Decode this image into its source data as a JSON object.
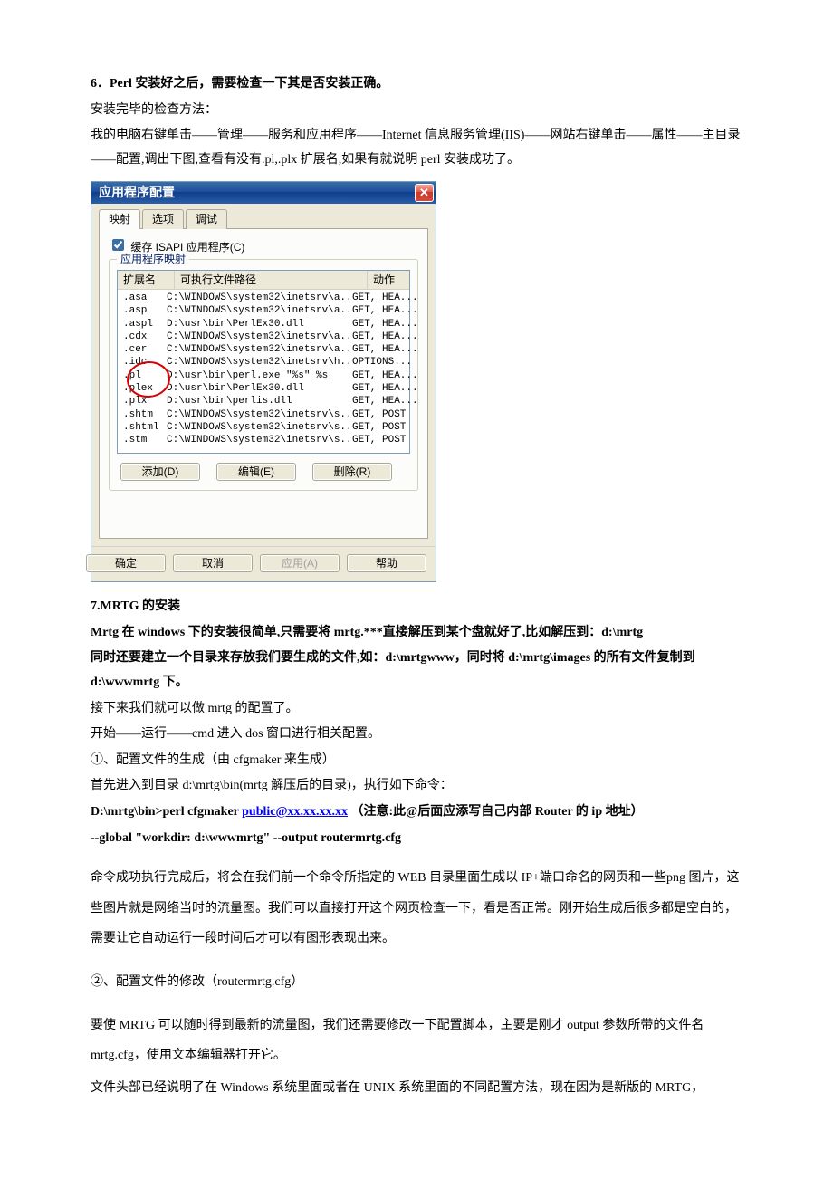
{
  "doc": {
    "step6_title": "6．Perl 安装好之后，需要检查一下其是否安装正确。",
    "check_method": "安装完毕的检查方法：",
    "check_path": "我的电脑右键单击——管理——服务和应用程序——Internet 信息服务管理(IIS)——网站右键单击——属性——主目录——配置,调出下图,查看有没有.pl,.plx 扩展名,如果有就说明 perl 安装成功了。",
    "step7_title": "7.MRTG 的安装",
    "mrtg1": "Mrtg 在 windows 下的安装很简单,只需要将 mrtg.***直接解压到某个盘就好了,比如解压到：d:\\mrtg",
    "mrtg2": "同时还要建立一个目录来存放我们要生成的文件,如：d:\\mrtgwww，同时将 d:\\mrtg\\images 的所有文件复制到 d:\\wwwmrtg 下。",
    "mrtg3": "接下来我们就可以做 mrtg 的配置了。",
    "mrtg4": "开始——运行——cmd 进入 dos 窗口进行相关配置。",
    "mrtg5": "①、配置文件的生成（由 cfgmaker 来生成）",
    "mrtg6": "首先进入到目录 d:\\mrtg\\bin(mrtg 解压后的目录)，执行如下命令：",
    "mrtg7a": "D:\\mrtg\\bin>perl cfgmaker   ",
    "mrtg7_link": "public@xx.xx.xx.xx",
    "mrtg7b": "（注意:此@后面应添写自己内部 Router 的 ip 地址）",
    "mrtg8": "--global \"workdir: d:\\wwwmrtg\" --output routermrtg.cfg",
    "mrtg9": "命令成功执行完成后，将会在我们前一个命令所指定的 WEB 目录里面生成以 IP+端口命名的网页和一些png 图片，这些图片就是网络当时的流量图。我们可以直接打开这个网页检查一下，看是否正常。刚开始生成后很多都是空白的，需要让它自动运行一段时间后才可以有图形表现出来。",
    "mrtg10": "②、配置文件的修改（routermrtg.cfg）",
    "mrtg11": "要使 MRTG 可以随时得到最新的流量图，我们还需要修改一下配置脚本，主要是刚才 output 参数所带的文件名 mrtg.cfg，使用文本编辑器打开它。",
    "mrtg12": "文件头部已经说明了在 Windows 系统里面或者在 UNIX 系统里面的不同配置方法，现在因为是新版的 MRTG，"
  },
  "dialog": {
    "title": "应用程序配置",
    "tabs": [
      "映射",
      "选项",
      "调试"
    ],
    "checkbox": "缓存 ISAPI 应用程序(C)",
    "legend": "应用程序映射",
    "cols": [
      "扩展名",
      "可执行文件路径",
      "动作"
    ],
    "rows": [
      {
        "ext": ".asa",
        "path": "C:\\WINDOWS\\system32\\inetsrv\\a...",
        "act": "GET, HEA..."
      },
      {
        "ext": ".asp",
        "path": "C:\\WINDOWS\\system32\\inetsrv\\a...",
        "act": "GET, HEA..."
      },
      {
        "ext": ".aspl",
        "path": "D:\\usr\\bin\\PerlEx30.dll",
        "act": "GET, HEA..."
      },
      {
        "ext": ".cdx",
        "path": "C:\\WINDOWS\\system32\\inetsrv\\a...",
        "act": "GET, HEA..."
      },
      {
        "ext": ".cer",
        "path": "C:\\WINDOWS\\system32\\inetsrv\\a...",
        "act": "GET, HEA..."
      },
      {
        "ext": ".idc",
        "path": "C:\\WINDOWS\\system32\\inetsrv\\h...",
        "act": "OPTIONS..."
      },
      {
        "ext": ".pl",
        "path": "D:\\usr\\bin\\perl.exe \"%s\" %s",
        "act": "GET, HEA..."
      },
      {
        "ext": ".plex",
        "path": "D:\\usr\\bin\\PerlEx30.dll",
        "act": "GET, HEA..."
      },
      {
        "ext": ".plx",
        "path": "D:\\usr\\bin\\perlis.dll",
        "act": "GET, HEA..."
      },
      {
        "ext": ".shtm",
        "path": "C:\\WINDOWS\\system32\\inetsrv\\s...",
        "act": "GET, POST"
      },
      {
        "ext": ".shtml",
        "path": "C:\\WINDOWS\\system32\\inetsrv\\s...",
        "act": "GET, POST"
      },
      {
        "ext": ".stm",
        "path": "C:\\WINDOWS\\system32\\inetsrv\\s...",
        "act": "GET, POST"
      }
    ],
    "btn_add": "添加(D)",
    "btn_edit": "编辑(E)",
    "btn_del": "删除(R)",
    "btn_ok": "确定",
    "btn_cancel": "取消",
    "btn_apply": "应用(A)",
    "btn_help": "帮助"
  }
}
